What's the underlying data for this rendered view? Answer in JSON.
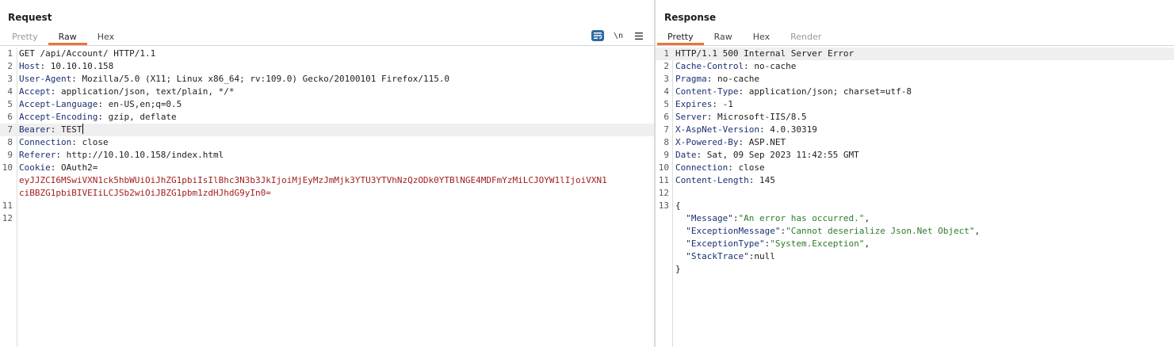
{
  "request": {
    "title": "Request",
    "tabs": [
      {
        "label": "Pretty",
        "state": "dim"
      },
      {
        "label": "Raw",
        "state": "active"
      },
      {
        "label": "Hex",
        "state": "normal"
      }
    ],
    "tools": {
      "wrap_icon": "wrap-lines-icon",
      "newline_label": "\\n",
      "menu_icon": "hamburger-menu-icon"
    },
    "lines": [
      {
        "n": "1",
        "key": "",
        "value": "GET /api/Account/ HTTP/1.1"
      },
      {
        "n": "2",
        "key": "Host",
        "value": ": 10.10.10.158"
      },
      {
        "n": "3",
        "key": "User-Agent",
        "value": ": Mozilla/5.0 (X11; Linux x86_64; rv:109.0) Gecko/20100101 Firefox/115.0"
      },
      {
        "n": "4",
        "key": "Accept",
        "value": ": application/json, text/plain, */*"
      },
      {
        "n": "5",
        "key": "Accept-Language",
        "value": ": en-US,en;q=0.5"
      },
      {
        "n": "6",
        "key": "Accept-Encoding",
        "value": ": gzip, deflate"
      },
      {
        "n": "7",
        "key": "Bearer",
        "value": ": TEST"
      },
      {
        "n": "8",
        "key": "Connection",
        "value": ": close"
      },
      {
        "n": "9",
        "key": "Referer",
        "value": ": http://10.10.10.158/index.html"
      },
      {
        "n": "10",
        "key": "Cookie",
        "value": ": OAuth2="
      },
      {
        "n": "",
        "cookie": "eyJJZCI6MSwiVXN1ck5hbWUiOiJhZG1pbiIsIlBhc3N3b3JkIjoiMjEyMzJmMjk3YTU3YTVhNzQzODk0YTBlNGE4MDFmYzMiLCJOYW1lIjoiVXN1"
      },
      {
        "n": "",
        "cookie": "ciBBZG1pbiBIVEIiLCJSb2wiOiJBZG1pbm1zdHJhdG9yIn0="
      },
      {
        "n": "11",
        "key": "",
        "value": ""
      },
      {
        "n": "12",
        "key": "",
        "value": ""
      }
    ]
  },
  "response": {
    "title": "Response",
    "tabs": [
      {
        "label": "Pretty",
        "state": "active"
      },
      {
        "label": "Raw",
        "state": "normal"
      },
      {
        "label": "Hex",
        "state": "normal"
      },
      {
        "label": "Render",
        "state": "dim"
      }
    ],
    "lines": [
      {
        "n": "1",
        "key": "",
        "value": "HTTP/1.1 500 Internal Server Error"
      },
      {
        "n": "2",
        "key": "Cache-Control",
        "value": ": no-cache"
      },
      {
        "n": "3",
        "key": "Pragma",
        "value": ": no-cache"
      },
      {
        "n": "4",
        "key": "Content-Type",
        "value": ": application/json; charset=utf-8"
      },
      {
        "n": "5",
        "key": "Expires",
        "value": ": -1"
      },
      {
        "n": "6",
        "key": "Server",
        "value": ": Microsoft-IIS/8.5"
      },
      {
        "n": "7",
        "key": "X-AspNet-Version",
        "value": ": 4.0.30319"
      },
      {
        "n": "8",
        "key": "X-Powered-By",
        "value": ": ASP.NET"
      },
      {
        "n": "9",
        "key": "Date",
        "value": ": Sat, 09 Sep 2023 11:42:55 GMT"
      },
      {
        "n": "10",
        "key": "Connection",
        "value": ": close"
      },
      {
        "n": "11",
        "key": "Content-Length",
        "value": ": 145"
      },
      {
        "n": "12",
        "key": "",
        "value": ""
      },
      {
        "n": "13",
        "key": "",
        "value": "{"
      },
      {
        "n": "",
        "jkey": "  \"Message\"",
        "jval": "\"An error has occurred.\"",
        "tail": ","
      },
      {
        "n": "",
        "jkey": "  \"ExceptionMessage\"",
        "jval": "\"Cannot deserialize Json.Net Object\"",
        "tail": ","
      },
      {
        "n": "",
        "jkey": "  \"ExceptionType\"",
        "jval": "\"System.Exception\"",
        "tail": ","
      },
      {
        "n": "",
        "jkey": "  \"StackTrace\"",
        "jnull": "null",
        "tail": ""
      },
      {
        "n": "",
        "key": "",
        "value": "}"
      }
    ]
  },
  "colors": {
    "accent": "#e8743b",
    "header_key": "#1a3173",
    "cookie": "#a31e1e",
    "json_string": "#2d7a2d",
    "tool_active": "#2e6aa5"
  }
}
